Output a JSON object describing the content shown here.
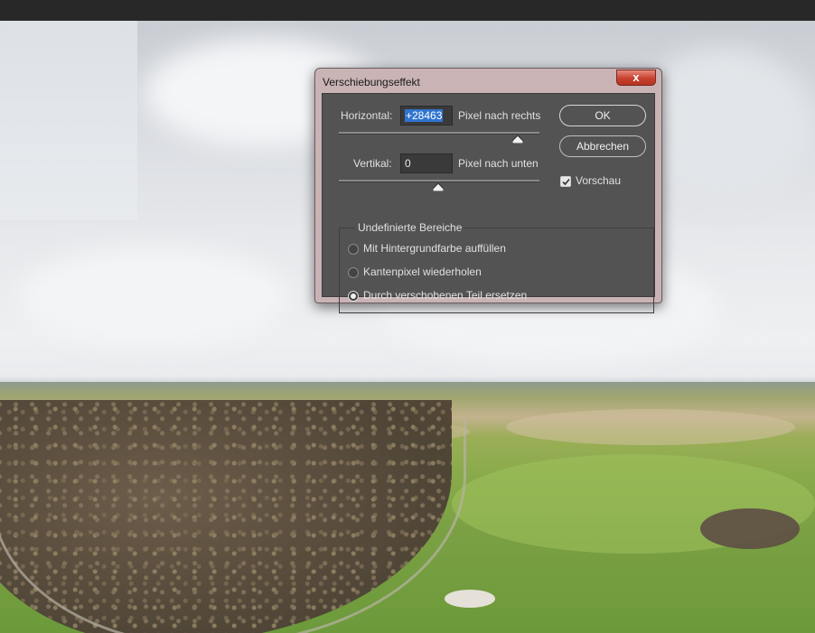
{
  "dialog": {
    "title": "Verschiebungseffekt",
    "close_label": "x",
    "horizontal": {
      "label": "Horizontal:",
      "value": "+28463",
      "unit": "Pixel nach rechts"
    },
    "vertical": {
      "label": "Vertikal:",
      "value": "0",
      "unit": "Pixel nach unten"
    },
    "ok_label": "OK",
    "cancel_label": "Abbrechen",
    "preview": {
      "label": "Vorschau",
      "checked": true
    },
    "undefined_areas": {
      "title": "Undefinierte Bereiche",
      "options": [
        {
          "label": "Mit Hintergrundfarbe auffüllen",
          "selected": false
        },
        {
          "label": "Kantenpixel wiederholen",
          "selected": false
        },
        {
          "label": "Durch verschobenen Teil ersetzen",
          "selected": true
        }
      ]
    }
  },
  "icons": {
    "close": "close-icon",
    "check": "checkmark-icon",
    "slider": "slider-thumb-icon"
  },
  "colors": {
    "dialog_bg": "#535353",
    "title_frame": "#c9b3b5",
    "selection": "#2f74d0",
    "close_button": "#c9402e"
  }
}
